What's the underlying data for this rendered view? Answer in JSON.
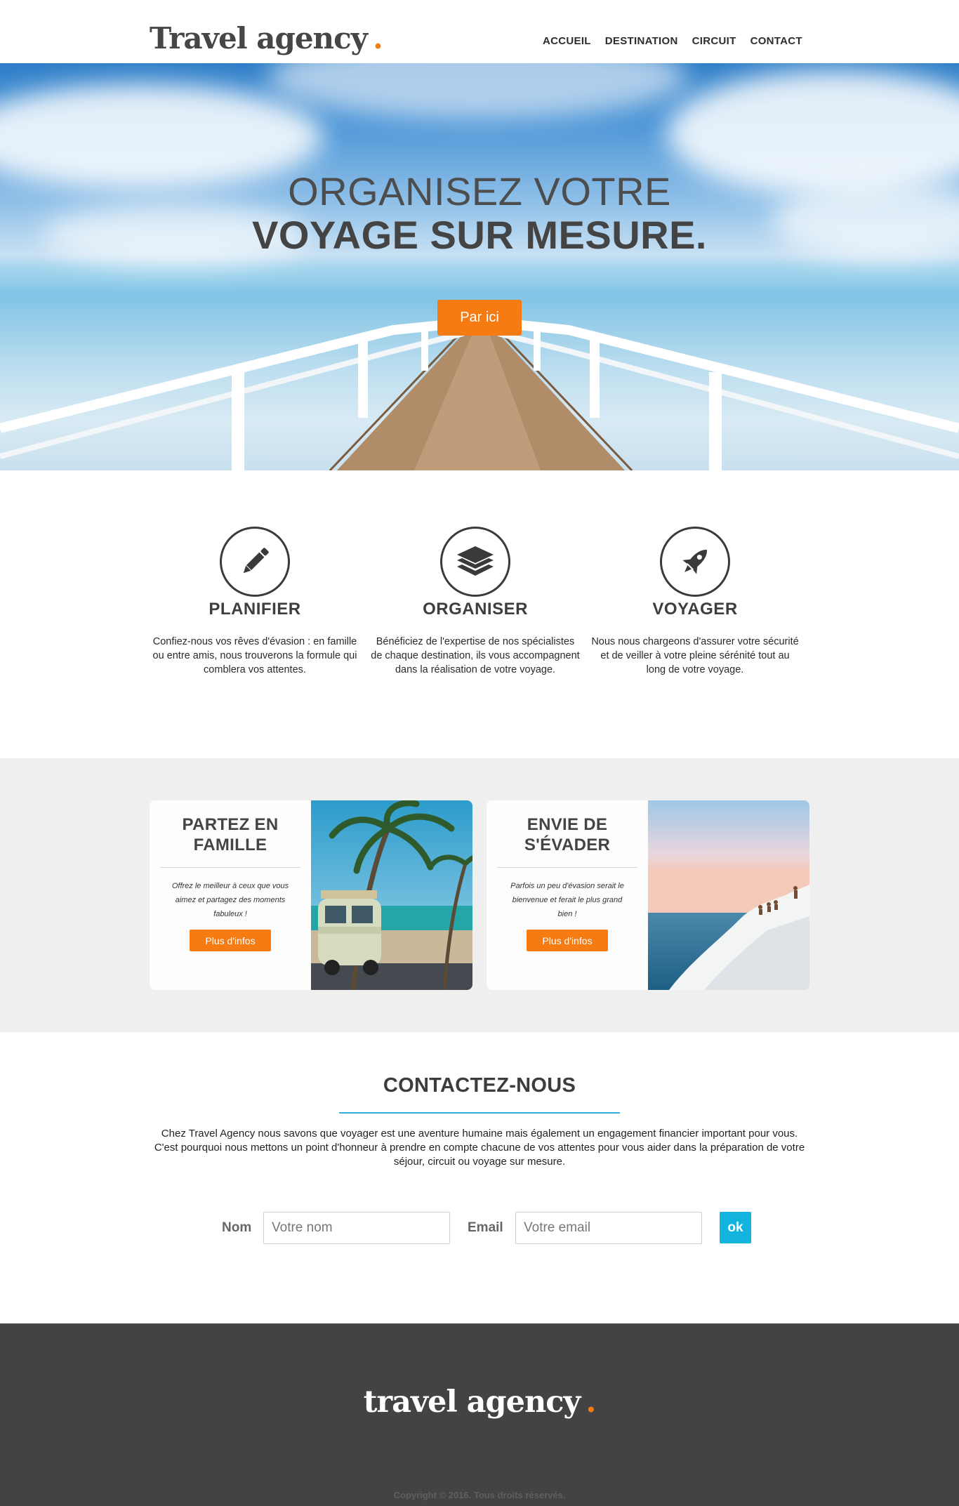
{
  "header": {
    "logo_text": "Travel agency",
    "logo_dot": ".",
    "nav": [
      "ACCUEIL",
      "DESTINATION",
      "CIRCUIT",
      "CONTACT"
    ]
  },
  "hero": {
    "title_line1": "ORGANISEZ VOTRE",
    "title_line2": "VOYAGE SUR MESURE.",
    "button_label": "Par ici"
  },
  "features": [
    {
      "icon": "pen-icon",
      "title": "PLANIFIER",
      "text": "Confiez-nous vos rêves d'évasion : en famille ou entre amis, nous trouverons la formule qui comblera vos attentes."
    },
    {
      "icon": "layers-icon",
      "title": "ORGANISER",
      "text": "Bénéficiez de l'expertise de nos spécialistes de chaque destination, ils vous accompagnent dans la réalisation de votre voyage."
    },
    {
      "icon": "rocket-icon",
      "title": "VOYAGER",
      "text": "Nous nous chargeons d'assurer votre sécurité et de veiller à votre pleine sérénité tout au long de votre voyage."
    }
  ],
  "cards": [
    {
      "title": "PARTEZ EN FAMILLE",
      "text": "Offrez le meilleur à ceux que vous aimez et partagez des moments fabuleux !",
      "button_label": "Plus d'infos"
    },
    {
      "title": "ENVIE DE S'ÉVADER",
      "text": "Parfois un peu d'évasion serait le bienvenue et ferait le plus grand bien !",
      "button_label": "Plus d'infos"
    }
  ],
  "contact": {
    "title": "CONTACTEZ-NOUS",
    "description": "Chez Travel Agency nous savons que voyager est une aventure humaine mais également un engagement financier important pour vous. C'est pourquoi nous mettons un point d'honneur à prendre en compte chacune de vos attentes pour vous aider dans la préparation de votre séjour, circuit ou voyage sur mesure.",
    "name_label": "Nom",
    "name_placeholder": "Votre nom",
    "email_label": "Email",
    "email_placeholder": "Votre email",
    "submit_label": "ok"
  },
  "footer": {
    "logo_text": "travel agency",
    "logo_dot": ".",
    "copyright": "Copyright © 2016. Tous droits réservés."
  },
  "colors": {
    "accent": "#f57b12",
    "contact_accent": "#12b3dd",
    "footer_bg": "#434343",
    "band_bg": "#efefef"
  }
}
